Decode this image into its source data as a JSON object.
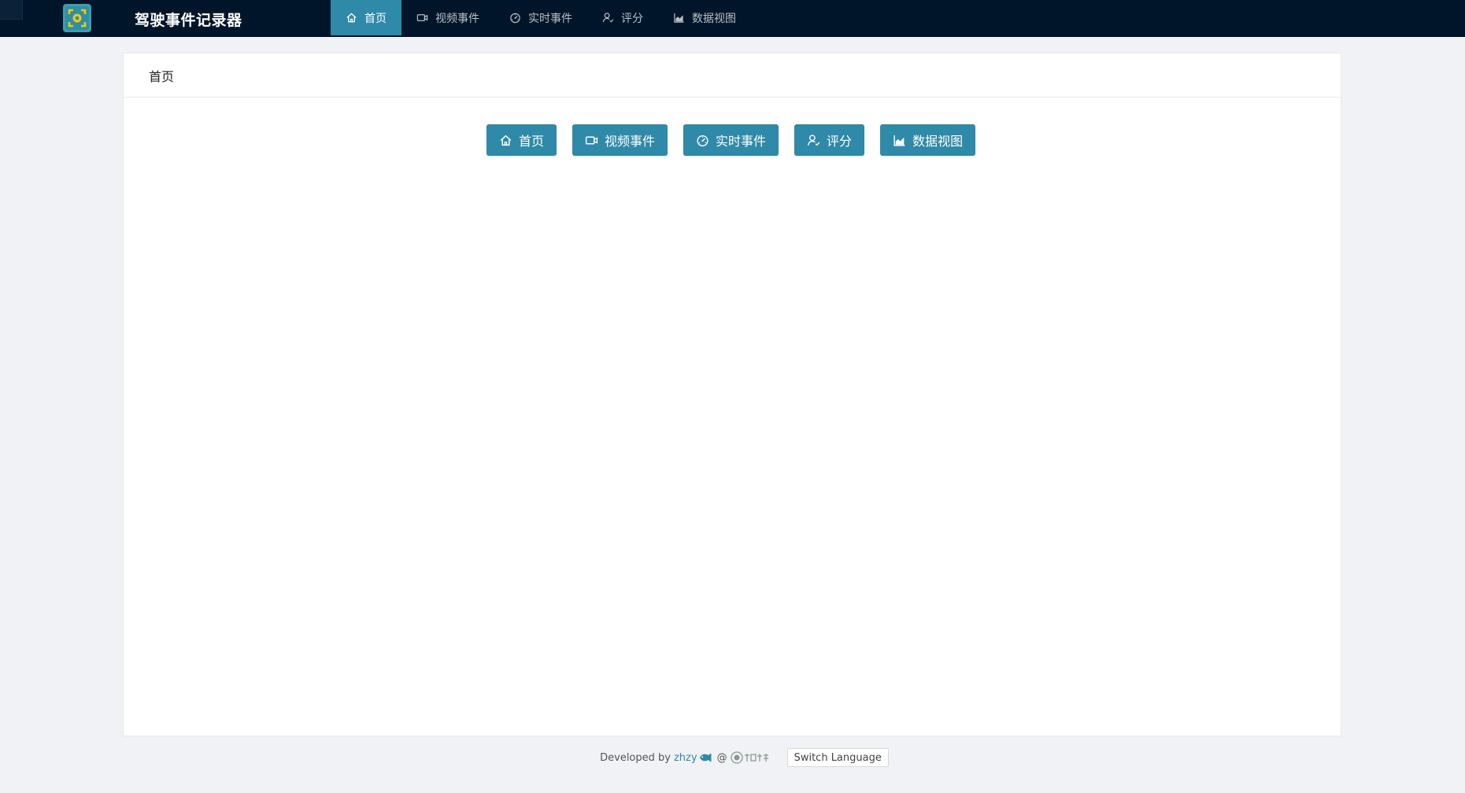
{
  "app": {
    "title": "驾驶事件记录器",
    "logo_icon": "camera-focus-icon"
  },
  "nav": {
    "active_index": 0,
    "items": [
      {
        "label": "首页",
        "icon": "home-icon"
      },
      {
        "label": "视频事件",
        "icon": "video-camera-icon"
      },
      {
        "label": "实时事件",
        "icon": "dashboard-icon"
      },
      {
        "label": "评分",
        "icon": "user-rating-icon"
      },
      {
        "label": "数据视图",
        "icon": "area-chart-icon"
      }
    ]
  },
  "page": {
    "breadcrumb": "首页",
    "quick_buttons": [
      {
        "label": "首页",
        "icon": "home-icon"
      },
      {
        "label": "视频事件",
        "icon": "video-camera-icon"
      },
      {
        "label": "实时事件",
        "icon": "dashboard-icon"
      },
      {
        "label": "评分",
        "icon": "user-rating-icon"
      },
      {
        "label": "数据视图",
        "icon": "area-chart-icon"
      }
    ]
  },
  "footer": {
    "developed_by": "Developed by",
    "developer": "zhzy",
    "at": "@",
    "switch_language": "Switch Language"
  },
  "colors": {
    "navbar_bg": "#001529",
    "accent": "#2f89a8",
    "page_bg": "#f0f2f5",
    "card_bg": "#ffffff"
  }
}
